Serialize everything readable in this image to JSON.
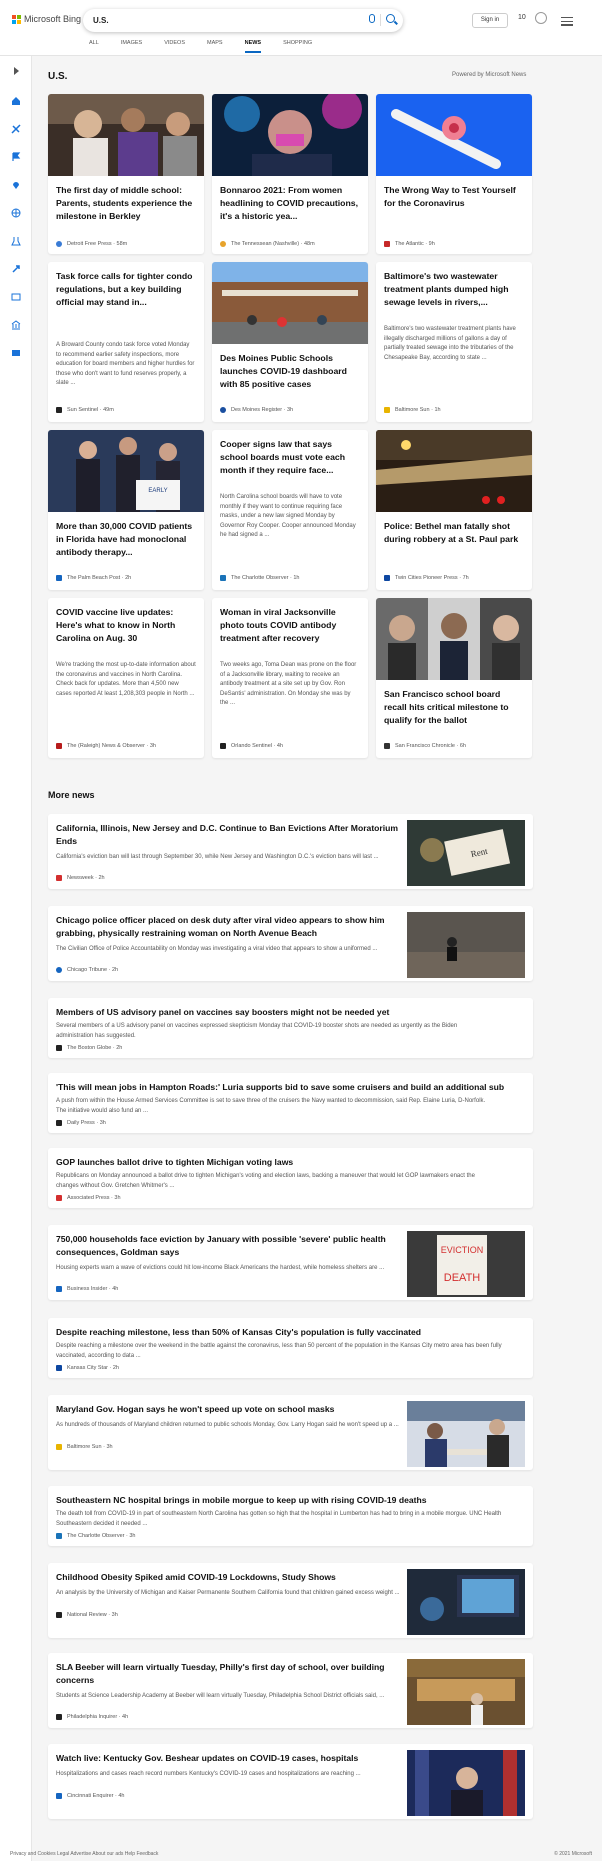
{
  "header": {
    "logo_text": "Microsoft Bing",
    "query": "U.S.",
    "sign_in": "Sign in",
    "rewards": "10",
    "tabs": [
      "ALL",
      "IMAGES",
      "VIDEOS",
      "MAPS",
      "NEWS",
      "SHOPPING"
    ],
    "active_tab": "NEWS"
  },
  "section": {
    "title": "U.S.",
    "powered_by": "Powered by Microsoft News"
  },
  "cards": [
    {
      "title": "The first day of middle school: Parents, students experience the milestone in Berkley",
      "desc": "",
      "source": "Detroit Free Press",
      "time": "58m",
      "color": "#3a7bd5"
    },
    {
      "title": "Bonnaroo 2021: From women headlining to COVID precautions, it's a historic yea...",
      "desc": "",
      "source": "The Tennessean (Nashville)",
      "time": "48m",
      "color": "#e7a32b"
    },
    {
      "title": "The Wrong Way to Test Yourself for the Coronavirus",
      "desc": "",
      "source": "The Atlantic",
      "time": "9h",
      "color": "#c62828"
    },
    {
      "title": "Task force calls for tighter condo regulations, but a key building official may stand in...",
      "desc": "A Broward County condo task force voted Monday to recommend earlier safety inspections, more education for board members and higher hurdles for those who don't want to fund reserves properly, a slate ...",
      "source": "Sun Sentinel",
      "time": "49m",
      "color": "#222"
    },
    {
      "title": "Des Moines Public Schools launches COVID-19 dashboard with 85 positive cases",
      "desc": "",
      "source": "Des Moines Register",
      "time": "3h",
      "color": "#1a4fa0"
    },
    {
      "title": "Baltimore's two wastewater treatment plants dumped high sewage levels in rivers,...",
      "desc": "Baltimore's two wastewater treatment plants have illegally discharged millions of gallons a day of partially treated sewage into the tributaries of the Chesapeake Bay, according to state ...",
      "source": "Baltimore Sun",
      "time": "1h",
      "color": "#e8b400"
    },
    {
      "title": "More than 30,000 COVID patients in Florida have had monoclonal antibody therapy...",
      "desc": "",
      "source": "The Palm Beach Post",
      "time": "2h",
      "color": "#1565c0"
    },
    {
      "title": "Cooper signs law that says school boards must vote each month if they require face...",
      "desc": "North Carolina school boards will have to vote monthly if they want to continue requiring face masks, under a new law signed Monday by Governor Roy Cooper. Cooper announced Monday he had signed a ...",
      "source": "The Charlotte Observer",
      "time": "1h",
      "color": "#1a73b8"
    },
    {
      "title": "Police: Bethel man fatally shot during robbery at a St. Paul park",
      "desc": "",
      "source": "Twin Cities Pioneer Press",
      "time": "7h",
      "color": "#0d47a1"
    },
    {
      "title": "COVID vaccine live updates: Here's what to know in North Carolina on Aug. 30",
      "desc": "We're tracking the most up-to-date information about the coronavirus and vaccines in North Carolina. Check back for updates. More than 4,500 new cases reported At least 1,208,303 people in North ...",
      "source": "The (Raleigh) News & Observer",
      "time": "3h",
      "color": "#b71c1c"
    },
    {
      "title": "Woman in viral Jacksonville photo touts COVID antibody treatment after recovery",
      "desc": "Two weeks ago, Toma Dean was prone on the floor of a Jacksonville library, waiting to receive an antibody treatment at a site set up by Gov. Ron DeSantis' administration. On Monday she was by the ...",
      "source": "Orlando Sentinel",
      "time": "4h",
      "color": "#222"
    },
    {
      "title": "San Francisco school board recall hits critical milestone to qualify for the ballot",
      "desc": "",
      "source": "San Francisco Chronicle",
      "time": "6h",
      "color": "#333"
    }
  ],
  "more_news": {
    "title": "More news",
    "items": [
      {
        "title": "California, Illinois, New Jersey and D.C. Continue to Ban Evictions After Moratorium Ends",
        "desc": "California's eviction ban will last through September 30, while New Jersey and Washington D.C.'s eviction bans will last ...",
        "source": "Newsweek",
        "time": "2h",
        "color": "#d32f2f",
        "thumb": "rent"
      },
      {
        "title": "Chicago police officer placed on desk duty after viral video appears to show him grabbing, physically restraining woman on North Avenue Beach",
        "desc": "The Civilian Office of Police Accountability on Monday was investigating a viral video that appears to show a uniformed ...",
        "source": "Chicago Tribune",
        "time": "2h",
        "color": "#1565c0",
        "thumb": "beach"
      },
      {
        "title": "Members of US advisory panel on vaccines say boosters might not be needed yet",
        "desc": "Several members of a US advisory panel on vaccines expressed skepticism Monday that COVID-19 booster shots are needed as urgently as the Biden administration has suggested.",
        "source": "The Boston Globe",
        "time": "2h",
        "color": "#222",
        "thumb": ""
      },
      {
        "title": "'This will mean jobs in Hampton Roads:' Luria supports bid to save some cruisers and build an additional sub",
        "desc": "A push from within the House Armed Services Committee is set to save three of the cruisers the Navy wanted to decommission, said Rep. Elaine Luria, D-Norfolk. The initiative would also fund an ...",
        "source": "Daily Press",
        "time": "3h",
        "color": "#222",
        "thumb": ""
      },
      {
        "title": "GOP launches ballot drive to tighten Michigan voting laws",
        "desc": "Republicans on Monday announced a ballot drive to tighten Michigan's voting and election laws, backing a maneuver that would let GOP lawmakers enact the changes without Gov. Gretchen Whitmer's ...",
        "source": "Associated Press",
        "time": "3h",
        "color": "#d32f2f",
        "thumb": ""
      },
      {
        "title": "750,000 households face eviction by January with possible 'severe' public health consequences, Goldman says",
        "desc": "Housing experts warn a wave of evictions could hit low-income Black Americans the hardest, while homeless shelters are ...",
        "source": "Business Insider",
        "time": "4h",
        "color": "#1565c0",
        "thumb": "eviction"
      },
      {
        "title": "Despite reaching milestone, less than 50% of Kansas City's population is fully vaccinated",
        "desc": "Despite reaching a milestone over the weekend in the battle against the coronavirus, less than 50 percent of the population in the Kansas City metro area has been fully vaccinated, according to data ...",
        "source": "Kansas City Star",
        "time": "2h",
        "color": "#0d47a1",
        "thumb": ""
      },
      {
        "title": "Maryland Gov. Hogan says he won't speed up vote on school masks",
        "desc": "As hundreds of thousands of Maryland children returned to public schools Monday, Gov. Larry Hogan said he won't speed up a ...",
        "source": "Baltimore Sun",
        "time": "3h",
        "color": "#e8b400",
        "thumb": "class"
      },
      {
        "title": "Southeastern NC hospital brings in mobile morgue to keep up with rising COVID-19 deaths",
        "desc": "The death toll from COVID-19 in part of southeastern North Carolina has gotten so high that the hospital in Lumberton has had to bring in a mobile morgue. UNC Health Southeastern decided it needed ...",
        "source": "The Charlotte Observer",
        "time": "3h",
        "color": "#1a73b8",
        "thumb": ""
      },
      {
        "title": "Childhood Obesity Spiked amid COVID-19 Lockdowns, Study Shows",
        "desc": "An analysis by the University of Michigan and Kaiser Permanente Southern California found that children gained excess weight ...",
        "source": "National Review",
        "time": "3h",
        "color": "#222",
        "thumb": "laptop"
      },
      {
        "title": "SLA Beeber will learn virtually Tuesday, Philly's first day of school, over building concerns",
        "desc": "Students at Science Leadership Academy at Beeber will learn virtually Tuesday, Philadelphia School District officials said, ...",
        "source": "Philadelphia Inquirer",
        "time": "4h",
        "color": "#222",
        "thumb": "hall"
      },
      {
        "title": "Watch live: Kentucky Gov. Beshear updates on COVID-19 cases, hospitals",
        "desc": "Hospitalizations and cases reach record numbers Kentucky's COVID-19 cases and hospitalizations are reaching ...",
        "source": "Cincinnati Enquirer",
        "time": "4h",
        "color": "#1565c0",
        "thumb": "podium"
      }
    ]
  },
  "footer": {
    "text": "Privacy and Cookies   Legal   Advertise   About our ads   Help   Feedback",
    "copy": "© 2021 Microsoft"
  }
}
